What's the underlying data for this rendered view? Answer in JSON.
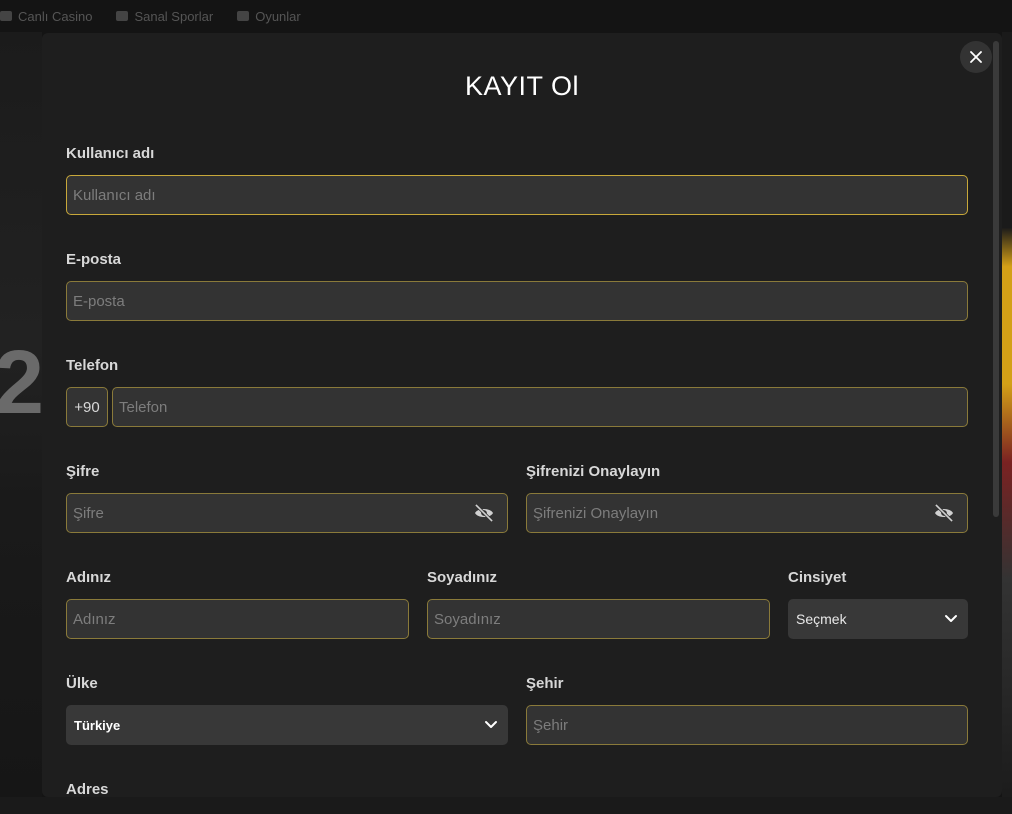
{
  "background": {
    "nav": [
      "Canlı Casino",
      "Sanal Sporlar",
      "Oyunlar"
    ],
    "big_text": "2"
  },
  "modal": {
    "title": "KAYIT Ol",
    "close_icon": "close-icon"
  },
  "form": {
    "username": {
      "label": "Kullanıcı adı",
      "placeholder": "Kullanıcı adı"
    },
    "email": {
      "label": "E-posta",
      "placeholder": "E-posta"
    },
    "phone": {
      "label": "Telefon",
      "prefix": "+90",
      "placeholder": "Telefon"
    },
    "password": {
      "label": "Şifre",
      "placeholder": "Şifre",
      "icon": "eye-off-icon"
    },
    "password_confirm": {
      "label": "Şifrenizi Onaylayın",
      "placeholder": "Şifrenizi Onaylayın",
      "icon": "eye-off-icon"
    },
    "first_name": {
      "label": "Adınız",
      "placeholder": "Adınız"
    },
    "last_name": {
      "label": "Soyadınız",
      "placeholder": "Soyadınız"
    },
    "gender": {
      "label": "Cinsiyet",
      "selected": "Seçmek"
    },
    "country": {
      "label": "Ülke",
      "selected": "Türkiye"
    },
    "city": {
      "label": "Şehir",
      "placeholder": "Şehir"
    },
    "address": {
      "label": "Adres"
    }
  },
  "colors": {
    "modal_bg": "#1e1e1e",
    "input_bg": "#333333",
    "input_border": "#8a7a3a",
    "accent": "#c8a83a"
  }
}
